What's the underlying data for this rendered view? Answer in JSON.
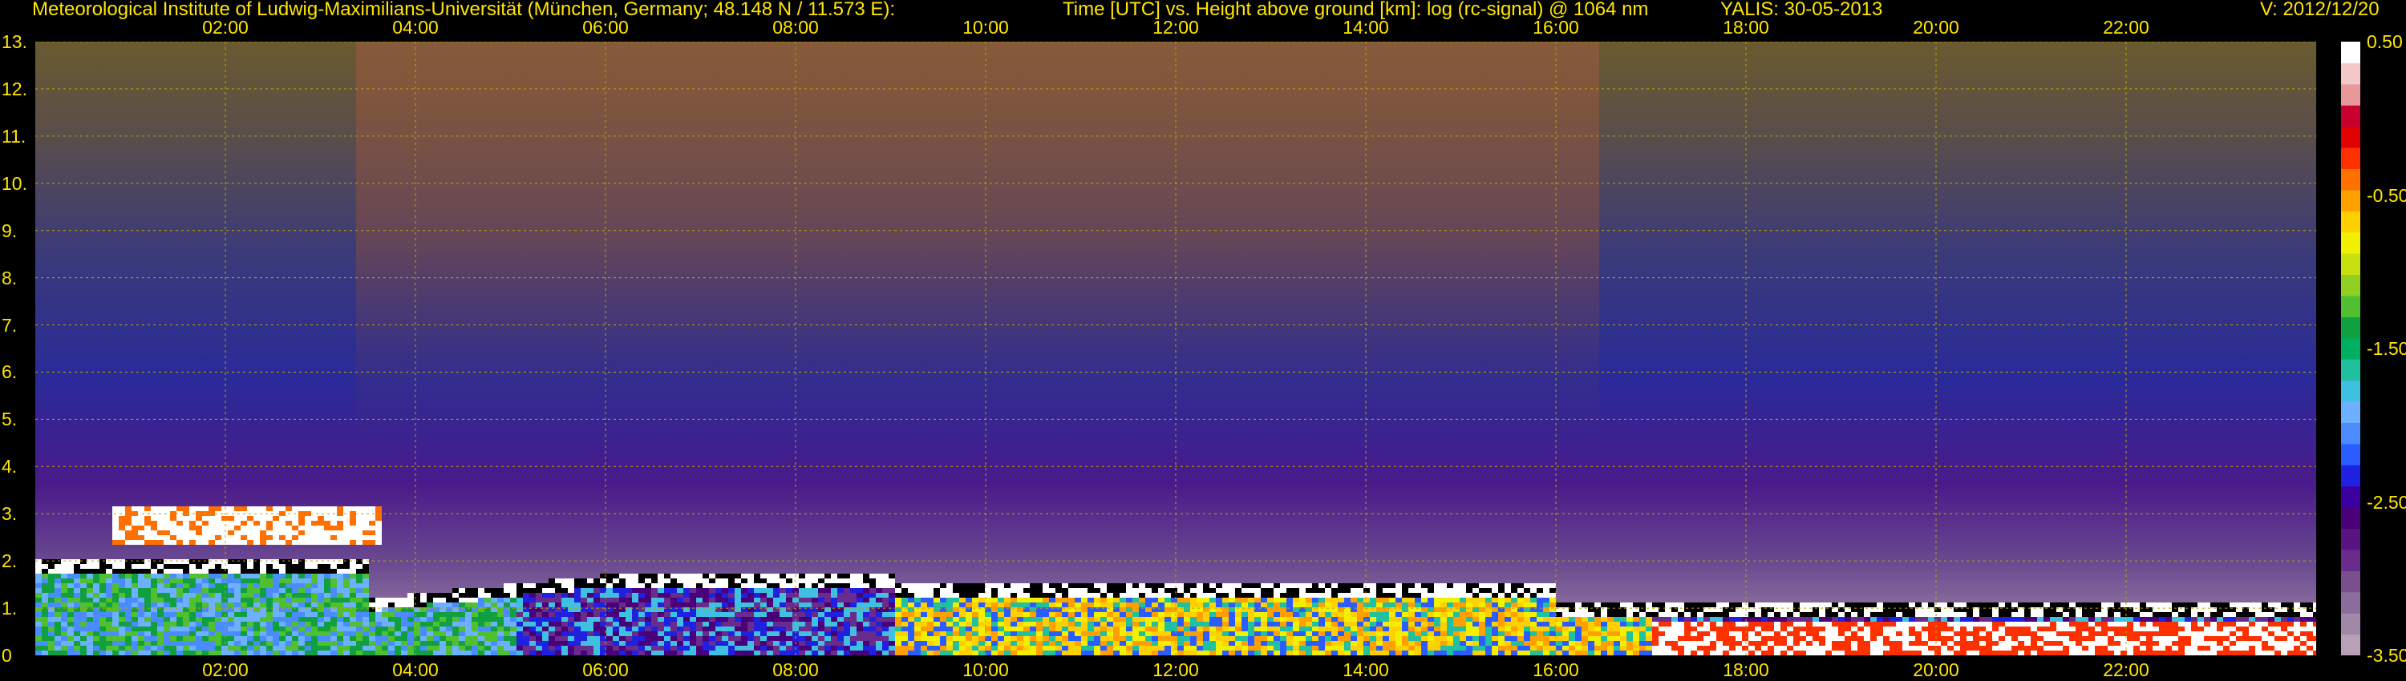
{
  "header": {
    "institute": "Meteorological Institute of Ludwig-Maximilians-Universität (München, Germany; 48.148 N / 11.573 E):",
    "description": "Time [UTC] vs. Height above ground [km]: log (rc-signal) @ 1064 nm",
    "instrument": "YALIS: 30-05-2013",
    "version": "V: 2012/12/20"
  },
  "colors": {
    "text": "#ffe600",
    "grid": "#b8a800",
    "background": "#000000"
  },
  "chart_data": {
    "type": "heatmap",
    "xlabel": "Time [UTC]",
    "ylabel": "Height above ground [km]",
    "x_ticks": [
      "02:00",
      "04:00",
      "06:00",
      "08:00",
      "10:00",
      "12:00",
      "14:00",
      "16:00",
      "18:00",
      "20:00",
      "22:00"
    ],
    "x_tick_hours": [
      2,
      4,
      6,
      8,
      10,
      12,
      14,
      16,
      18,
      20,
      22
    ],
    "xlim_hours": [
      0,
      24
    ],
    "y_ticks": [
      "0",
      "1.",
      "2.",
      "3.",
      "4.",
      "5.",
      "6.",
      "7.",
      "8.",
      "9.",
      "10.",
      "11.",
      "12.",
      "13."
    ],
    "y_tick_values": [
      0,
      1,
      2,
      3,
      4,
      5,
      6,
      7,
      8,
      9,
      10,
      11,
      12,
      13
    ],
    "ylim": [
      0,
      13
    ],
    "grid": true,
    "colorbar": {
      "labels": [
        "0.50",
        "-0.50",
        "-1.50",
        "-2.50",
        "-3.50"
      ],
      "values": [
        0.5,
        -0.5,
        -1.5,
        -2.5,
        -3.5
      ],
      "range": [
        -3.5,
        0.5
      ],
      "palette": [
        "#b8a0b8",
        "#a088a8",
        "#8c6c9c",
        "#7a4f90",
        "#6a2c8c",
        "#5a1482",
        "#4a0078",
        "#3a00a0",
        "#2020e0",
        "#2a5cff",
        "#4a8cff",
        "#6cb0ff",
        "#40c0e0",
        "#20c0a0",
        "#00b060",
        "#10a040",
        "#50c030",
        "#90d020",
        "#c8e010",
        "#f0f000",
        "#ffd000",
        "#ffa000",
        "#ff7000",
        "#ff3000",
        "#e00000",
        "#c80030",
        "#e89898",
        "#f4c8c8",
        "#ffffff"
      ]
    }
  }
}
